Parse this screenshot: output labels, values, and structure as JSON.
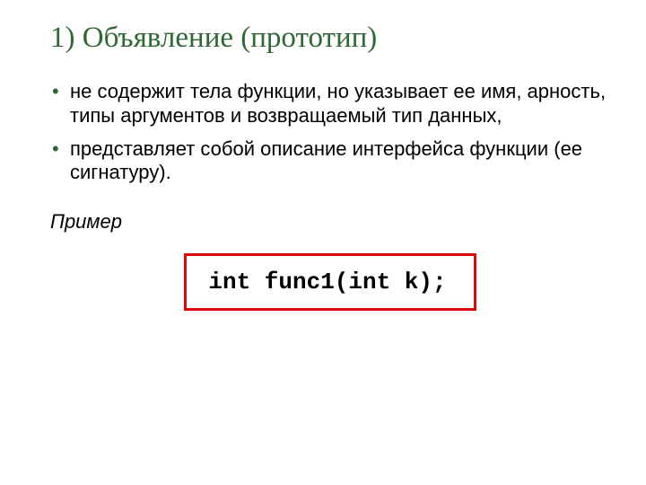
{
  "title": "1) Объявление (прототип)",
  "bullets": [
    "не содержит тела функции, но указывает ее имя, арность, типы аргументов и возвращаемый тип данных,",
    "представляет собой описание интерфейса функции (ее сигнатуру)."
  ],
  "example_label": "Пример",
  "code": "int func1(int k);"
}
